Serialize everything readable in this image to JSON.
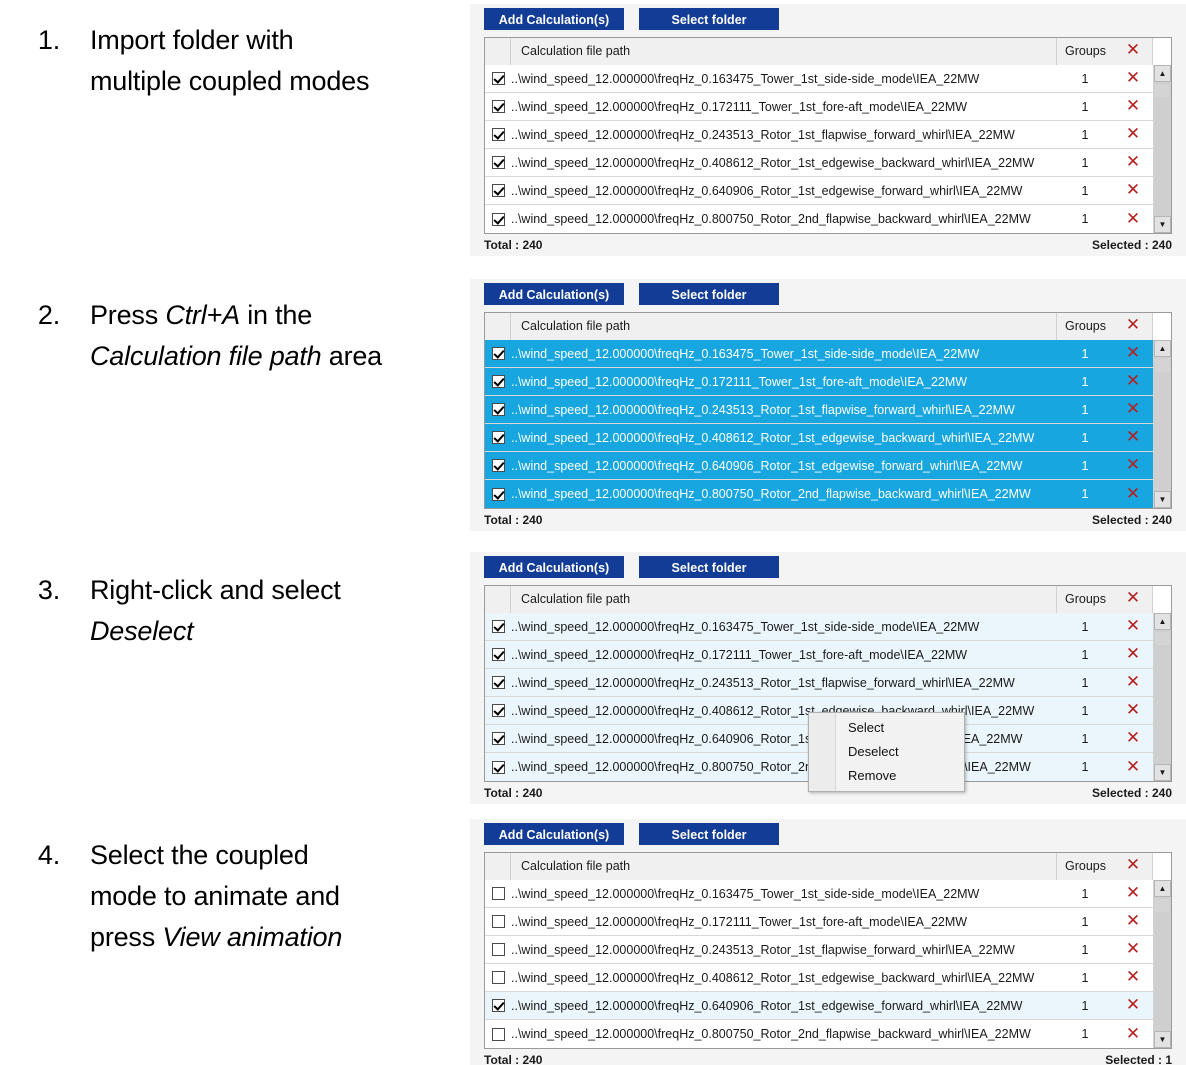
{
  "steps": [
    {
      "number": "1.",
      "lines": [
        [
          {
            "t": "Import folder with",
            "i": false
          }
        ],
        [
          {
            "t": "multiple coupled modes",
            "i": false
          }
        ]
      ]
    },
    {
      "number": "2.",
      "lines": [
        [
          {
            "t": "Press ",
            "i": false
          },
          {
            "t": "Ctrl+A",
            "i": true
          },
          {
            "t": " in the",
            "i": false
          }
        ],
        [
          {
            "t": "Calculation file path",
            "i": true
          },
          {
            "t": " area",
            "i": false
          }
        ]
      ]
    },
    {
      "number": "3.",
      "lines": [
        [
          {
            "t": "Right-click and select",
            "i": false
          }
        ],
        [
          {
            "t": "Deselect",
            "i": true
          }
        ]
      ]
    },
    {
      "number": "4.",
      "lines": [
        [
          {
            "t": "Select the coupled",
            "i": false
          }
        ],
        [
          {
            "t": "mode to animate and",
            "i": false
          }
        ],
        [
          {
            "t": "press ",
            "i": false
          },
          {
            "t": "View animation",
            "i": true
          }
        ]
      ]
    }
  ],
  "toolbar": {
    "add_label": "Add Calculation(s)",
    "folder_label": "Select folder"
  },
  "columns": {
    "path": "Calculation file path",
    "groups": "Groups",
    "delete_all_icon": "x-icon"
  },
  "paths": [
    "..\\wind_speed_12.000000\\freqHz_0.163475_Tower_1st_side-side_mode\\IEA_22MW",
    "..\\wind_speed_12.000000\\freqHz_0.172111_Tower_1st_fore-aft_mode\\IEA_22MW",
    "..\\wind_speed_12.000000\\freqHz_0.243513_Rotor_1st_flapwise_forward_whirl\\IEA_22MW",
    "..\\wind_speed_12.000000\\freqHz_0.408612_Rotor_1st_edgewise_backward_whirl\\IEA_22MW",
    "..\\wind_speed_12.000000\\freqHz_0.640906_Rotor_1st_edgewise_forward_whirl\\IEA_22MW",
    "..\\wind_speed_12.000000\\freqHz_0.800750_Rotor_2nd_flapwise_backward_whirl\\IEA_22MW"
  ],
  "groups_value": "1",
  "panels": [
    {
      "id": "panel-1",
      "checked": [
        true,
        true,
        true,
        true,
        true,
        true
      ],
      "row_style": [
        "plain",
        "plain",
        "plain",
        "plain",
        "plain",
        "plain"
      ],
      "total": "Total :  240",
      "selected": "Selected :  240",
      "context_menu": false
    },
    {
      "id": "panel-2",
      "checked": [
        true,
        true,
        true,
        true,
        true,
        true
      ],
      "row_style": [
        "sel",
        "sel",
        "sel",
        "sel",
        "sel",
        "sel"
      ],
      "total": "Total :  240",
      "selected": "Selected :  240",
      "context_menu": false
    },
    {
      "id": "panel-3",
      "checked": [
        true,
        true,
        true,
        true,
        true,
        true
      ],
      "row_style": [
        "tint",
        "tint",
        "tint",
        "tint",
        "tint",
        "tint"
      ],
      "total": "Total :  240",
      "selected": "Selected :  240",
      "context_menu": true
    },
    {
      "id": "panel-4",
      "checked": [
        false,
        false,
        false,
        false,
        true,
        false
      ],
      "row_style": [
        "plain",
        "plain",
        "plain",
        "plain",
        "tint",
        "plain"
      ],
      "total": "Total :  240",
      "selected": "Selected :  1",
      "context_menu": false
    }
  ],
  "context_menu": {
    "items": [
      "Select",
      "Deselect",
      "Remove"
    ]
  },
  "colors": {
    "button_blue": "#123c96",
    "selection_blue": "#17a6e0",
    "row_tint": "#eaf6fb",
    "delete_red": "#b42121",
    "panel_bg": "#f4f4f4"
  },
  "scrollbar": {
    "up_glyph": "▲",
    "down_glyph": "▼"
  }
}
